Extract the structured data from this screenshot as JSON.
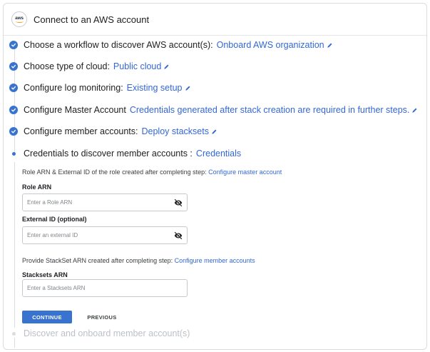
{
  "header": {
    "logo_text": "aws",
    "title": "Connect to an AWS account"
  },
  "steps": [
    {
      "label": "Choose a workflow to discover AWS account(s):",
      "value": "Onboard AWS organization",
      "status": "complete"
    },
    {
      "label": "Choose type of cloud:",
      "value": "Public cloud",
      "status": "complete"
    },
    {
      "label": "Configure log monitoring:",
      "value": "Existing setup",
      "status": "complete"
    },
    {
      "label": "Configure Master Account",
      "value": "Credentials generated after stack creation are required in further steps.",
      "status": "complete"
    },
    {
      "label": "Configure member accounts:",
      "value": "Deploy stacksets",
      "status": "complete"
    },
    {
      "label": "Credentials to discover member accounts :",
      "value": "Credentials",
      "status": "active"
    },
    {
      "label": "Discover and onboard member account(s)",
      "value": "",
      "status": "pending"
    }
  ],
  "form": {
    "role_help_text": "Role ARN & External ID of the role created after completing step:",
    "role_help_link": "Configure master account",
    "role_arn_label": "Role ARN",
    "role_arn_placeholder": "Enter a Role ARN",
    "external_id_label": "External ID (optional)",
    "external_id_placeholder": "Enter an external ID",
    "stackset_help_text": "Provide StackSet ARN created after completing step:",
    "stackset_help_link": "Configure member accounts",
    "stackset_arn_label": "Stacksets ARN",
    "stackset_arn_placeholder": "Enter a Stacksets ARN",
    "continue_label": "CONTINUE",
    "previous_label": "PREVIOUS"
  },
  "colors": {
    "accent": "#3873cf",
    "link": "#3367d6",
    "pending": "#bdc1c6"
  },
  "icons": {
    "complete": "check-circle-icon",
    "edit": "pencil-icon",
    "hide": "eye-off-icon"
  }
}
